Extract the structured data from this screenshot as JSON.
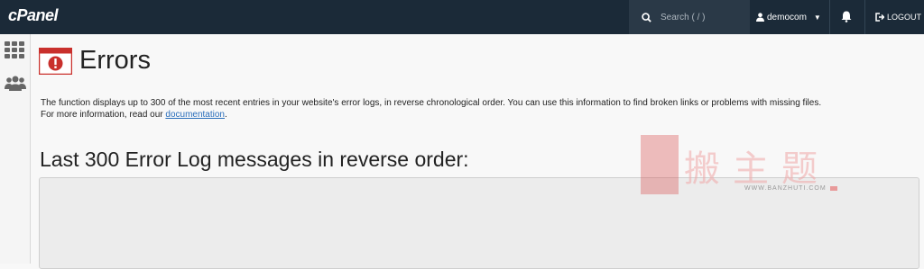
{
  "header": {
    "brand": "cPanel",
    "search_placeholder": "Search ( / )",
    "user": "democom",
    "logout": "LOGOUT"
  },
  "page": {
    "title": "Errors",
    "description_main": "The function displays up to 300 of the most recent entries in your website's error logs, in reverse chronological order. You can use this information to find broken links or problems with missing files.",
    "description_more_prefix": "For more information, read our ",
    "documentation_link": "documentation",
    "description_more_suffix": ".",
    "subheading": "Last 300 Error Log messages in reverse order:"
  },
  "watermark": {
    "chars": "搬主题",
    "url": "WWW.BANZHUTI.COM"
  },
  "icons": [
    "search-icon",
    "user-icon",
    "caret-down-icon",
    "bell-icon",
    "logout-icon",
    "apps-grid-icon",
    "users-icon",
    "error-page-icon"
  ],
  "colors": {
    "topbar": "#1b2a38",
    "link": "#2a6ebb",
    "error_icon": "#c9302c"
  }
}
